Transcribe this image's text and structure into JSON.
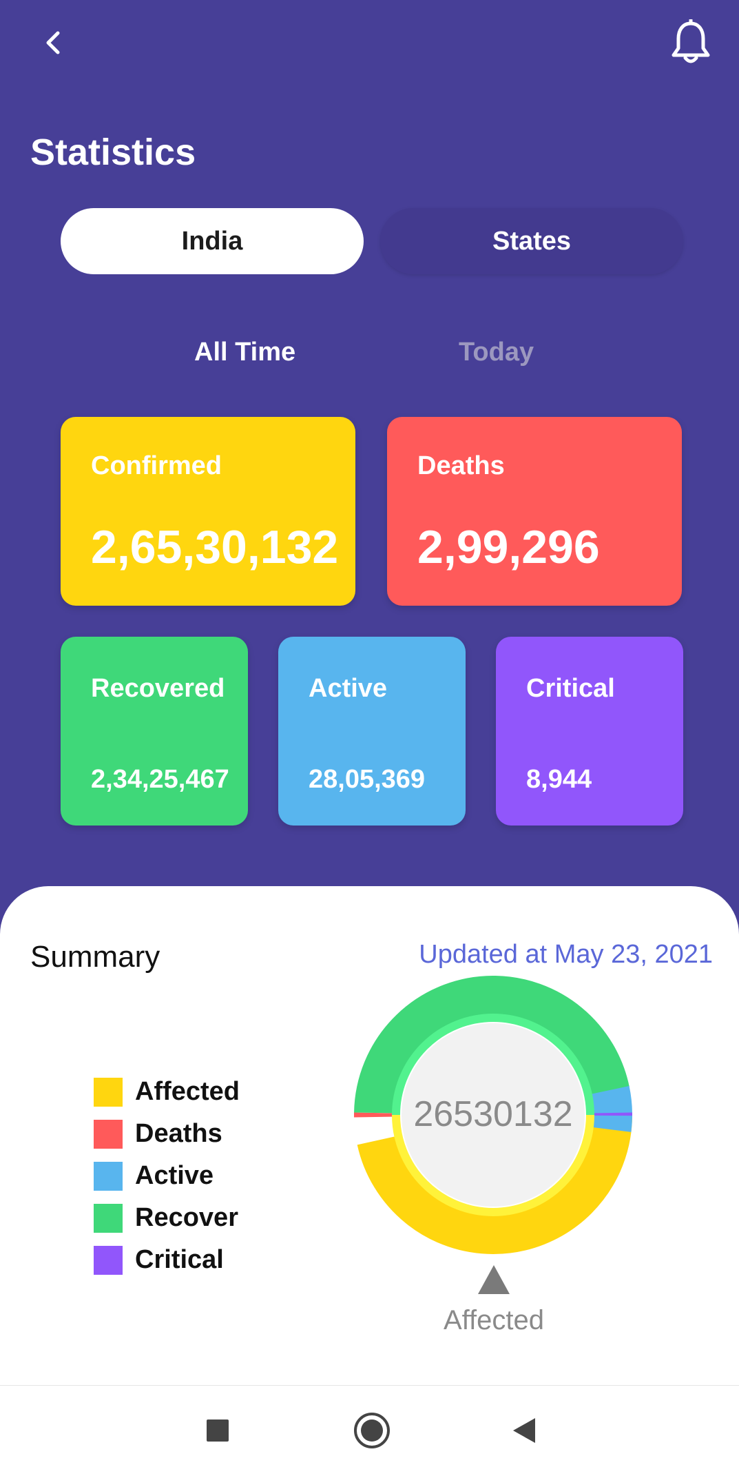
{
  "colors": {
    "background": "#473F97",
    "affected": "#FFD60F",
    "deaths": "#FF5A5A",
    "active": "#58B5EE",
    "recovered": "#3FD879",
    "critical": "#9156FB",
    "accent_link": "#5A67D8"
  },
  "header": {
    "back_icon": "chevron-left-icon",
    "notification_icon": "bell-icon",
    "title": "Statistics"
  },
  "region_tabs": [
    {
      "label": "India",
      "selected": true
    },
    {
      "label": "States",
      "selected": false
    }
  ],
  "time_tabs": [
    {
      "label": "All Time",
      "selected": true
    },
    {
      "label": "Today",
      "selected": false
    }
  ],
  "stats": {
    "confirmed": {
      "label": "Confirmed",
      "value": "2,65,30,132"
    },
    "deaths": {
      "label": "Deaths",
      "value": "2,99,296"
    },
    "recovered": {
      "label": "Recovered",
      "value": "2,34,25,467"
    },
    "active": {
      "label": "Active",
      "value": "28,05,369"
    },
    "critical": {
      "label": "Critical",
      "value": "8,944"
    }
  },
  "summary": {
    "title": "Summary",
    "updated": "Updated at May 23, 2021",
    "legend": [
      "Affected",
      "Deaths",
      "Active",
      "Recover",
      "Critical"
    ],
    "donut": {
      "center_value": "26530132",
      "selected_label": "Affected",
      "values": {
        "Affected": 26530132,
        "Deaths": 299296,
        "Active": 2805369,
        "Recover": 23425467,
        "Critical": 8944
      }
    }
  },
  "navbar": {
    "icons": [
      "square-icon",
      "home-circle-icon",
      "triangle-back-icon"
    ]
  }
}
